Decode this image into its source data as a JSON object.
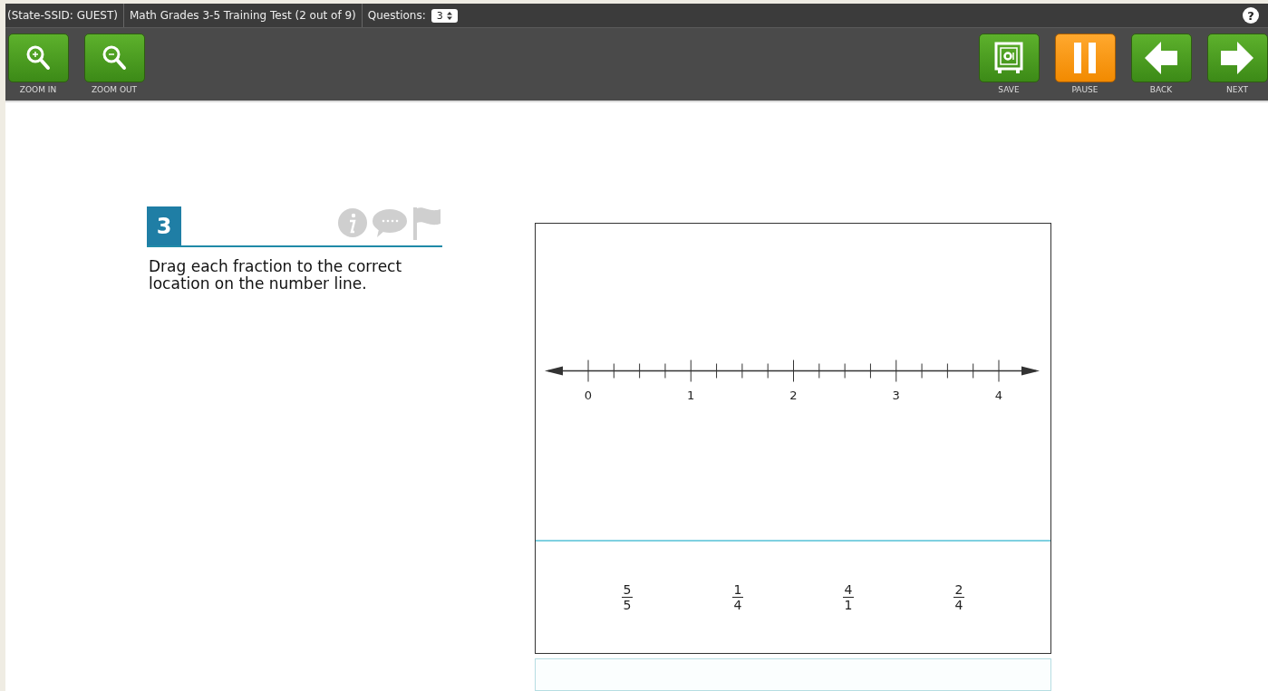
{
  "top_bar": {
    "student": "(State-SSID: GUEST)",
    "test": "Math Grades 3-5 Training Test (2 out of 9)",
    "questions_label": "Questions:",
    "question_select": "3",
    "help": "?"
  },
  "toolbar": {
    "left": [
      {
        "kind": "zoom-in",
        "label": "ZOOM IN"
      },
      {
        "kind": "zoom-out",
        "label": "ZOOM OUT"
      }
    ],
    "right": [
      {
        "kind": "save",
        "label": "SAVE"
      },
      {
        "kind": "pause",
        "label": "PAUSE"
      },
      {
        "kind": "back",
        "label": "BACK"
      },
      {
        "kind": "next",
        "label": "NEXT"
      }
    ]
  },
  "question": {
    "number": "3",
    "prompt": "Drag each fraction to the correct location on the number line."
  },
  "number_line": {
    "labels": [
      "0",
      "1",
      "2",
      "3",
      "4"
    ]
  },
  "fractions": [
    {
      "numerator": "5",
      "denominator": "5"
    },
    {
      "numerator": "1",
      "denominator": "4"
    },
    {
      "numerator": "4",
      "denominator": "1"
    },
    {
      "numerator": "2",
      "denominator": "4"
    }
  ]
}
